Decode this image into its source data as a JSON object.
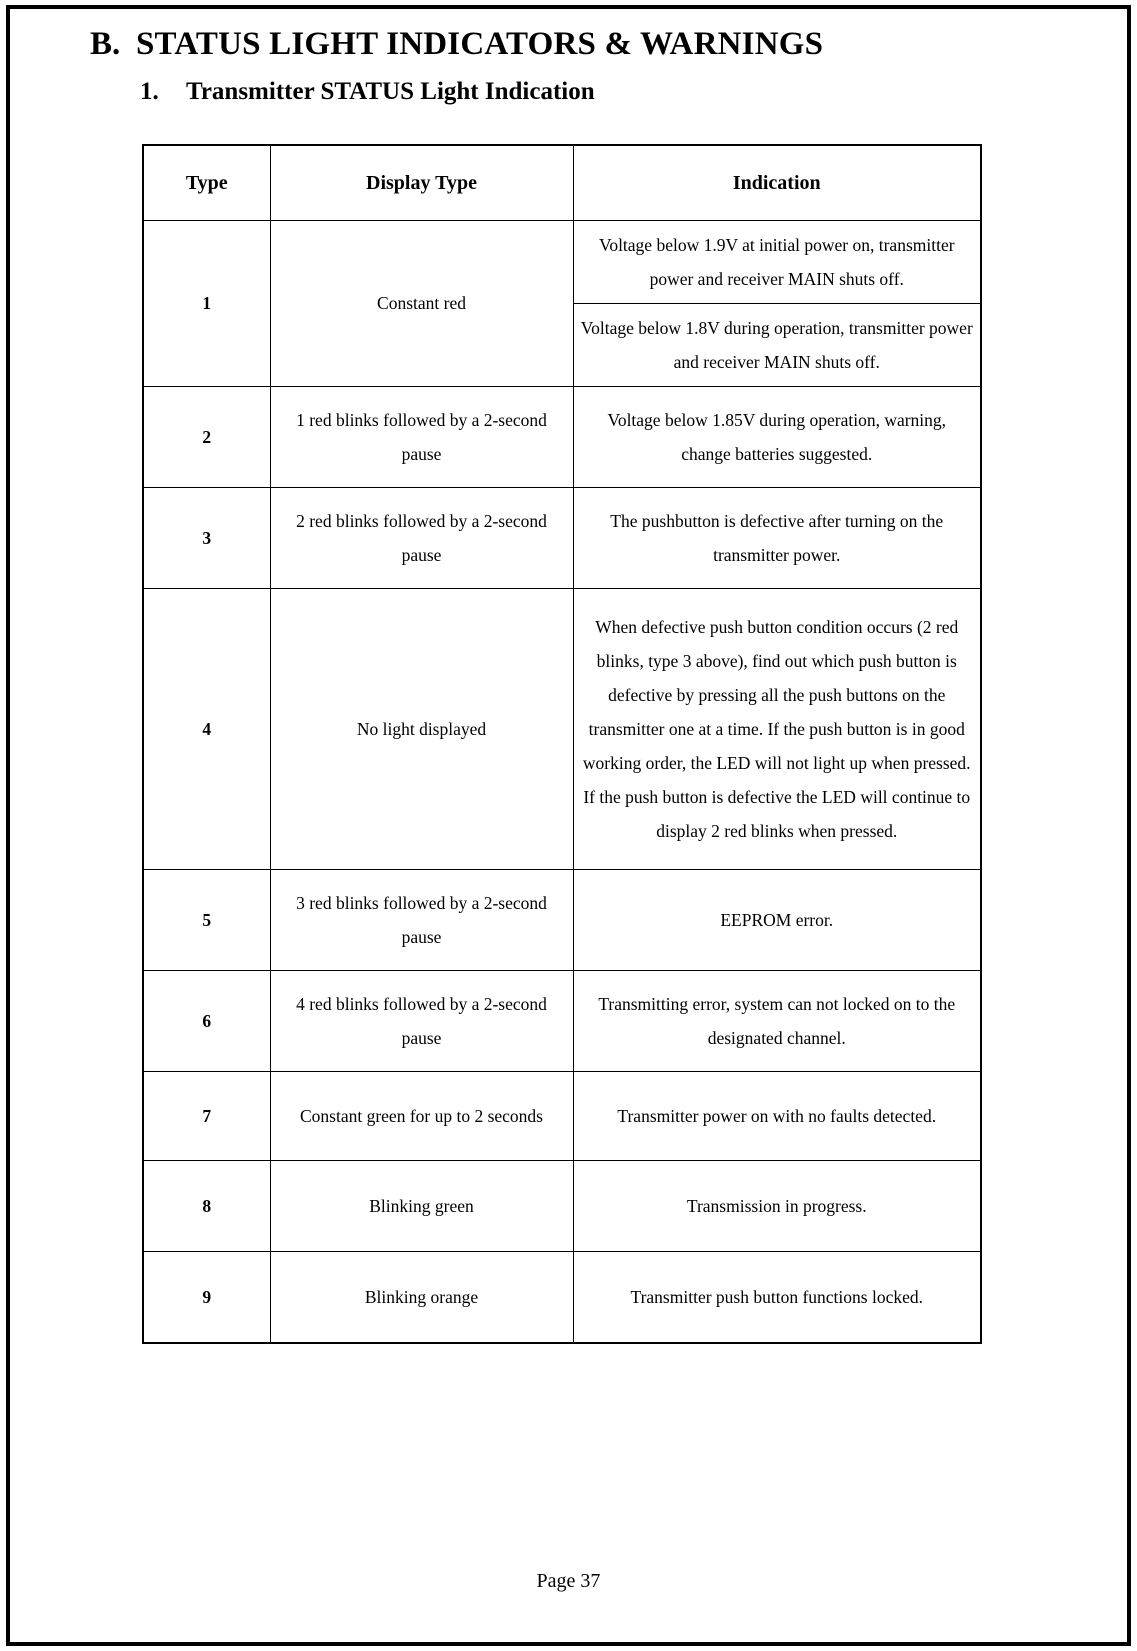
{
  "document": {
    "section_letter": "B.",
    "section_title": "STATUS LIGHT INDICATORS & WARNINGS",
    "subsection_number": "1.",
    "subsection_title": "Transmitter STATUS Light Indication",
    "footer": "Page 37"
  },
  "table": {
    "headers": {
      "type": "Type",
      "display_type": "Display Type",
      "indication": "Indication"
    },
    "rows": [
      {
        "type": "1",
        "display_type": "Constant red",
        "indication_1": "Voltage below 1.9V at initial power on, transmitter power and receiver MAIN shuts off.",
        "indication_2": "Voltage below 1.8V during operation, transmitter power and receiver MAIN shuts off."
      },
      {
        "type": "2",
        "display_type": "1 red blinks followed by a 2-second pause",
        "indication": "Voltage below 1.85V during operation, warning, change batteries suggested."
      },
      {
        "type": "3",
        "display_type": "2 red blinks followed by a 2-second pause",
        "indication": "The pushbutton is defective after turning on the transmitter power."
      },
      {
        "type": "4",
        "display_type": "No light displayed",
        "indication": "When defective push button condition occurs (2 red blinks, type 3 above), find out which push button is defective by pressing all the push buttons on the transmitter one at a time. If the push button is in good working order, the LED will not light up when pressed. If the push button is defective the LED will continue to display 2 red blinks when pressed."
      },
      {
        "type": "5",
        "display_type": "3 red blinks followed by a 2-second pause",
        "indication": "EEPROM error."
      },
      {
        "type": "6",
        "display_type": "4 red blinks followed by a 2-second pause",
        "indication": "Transmitting error, system can not locked on to the designated channel."
      },
      {
        "type": "7",
        "display_type": "Constant green for up to 2 seconds",
        "indication": "Transmitter power on with no faults detected."
      },
      {
        "type": "8",
        "display_type": "Blinking green",
        "indication": "Transmission in progress."
      },
      {
        "type": "9",
        "display_type": "Blinking orange",
        "indication": "Transmitter push button functions locked."
      }
    ]
  }
}
